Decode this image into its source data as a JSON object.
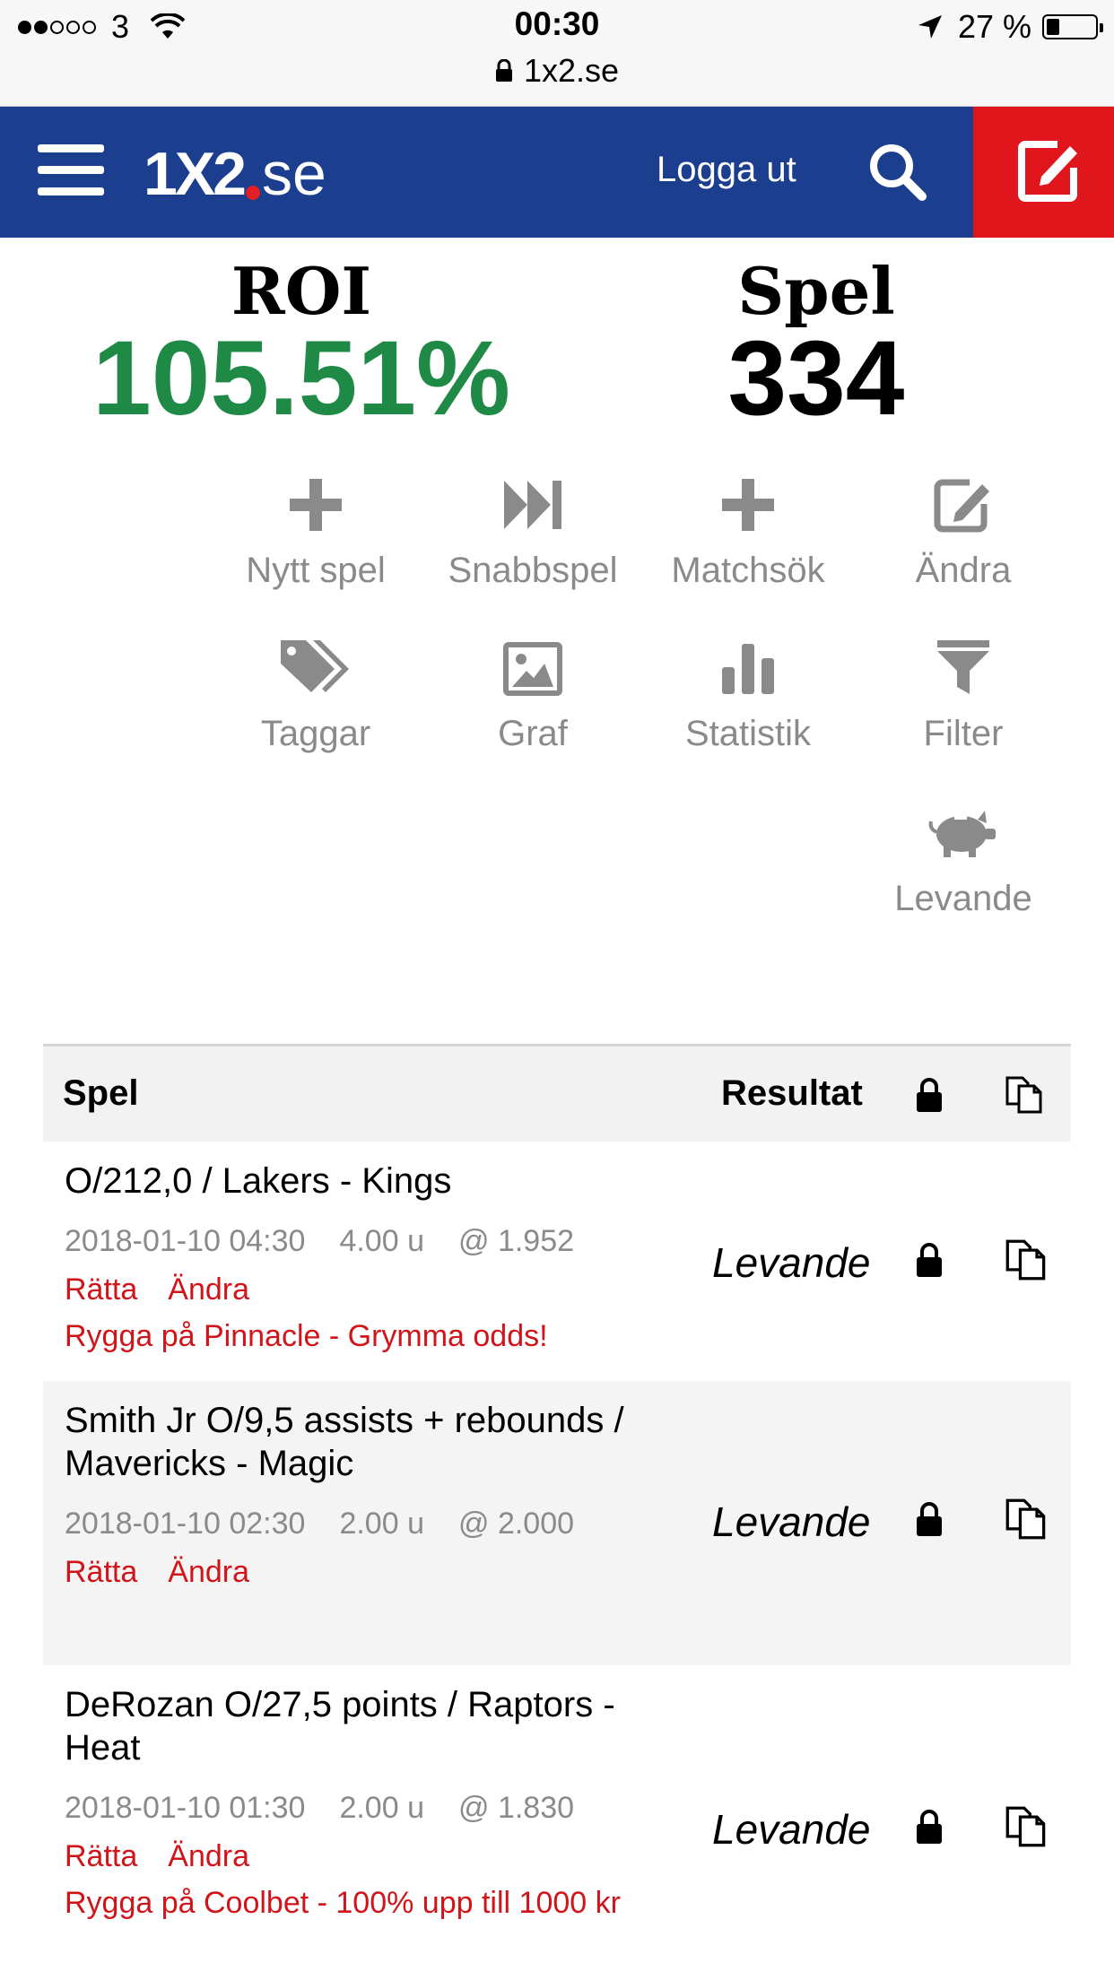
{
  "status_bar": {
    "carrier": "3",
    "time": "00:30",
    "url": "1x2.se",
    "battery": "27 %",
    "battery_level": 0.27
  },
  "header": {
    "logo_main": "1X2",
    "logo_suffix": "se",
    "logout_label": "Logga ut",
    "brand_blue": "#1b3f8e",
    "brand_red": "#e0161c"
  },
  "stats": {
    "roi_label": "ROI",
    "roi_value": "105.51%",
    "roi_color": "#1e8a46",
    "games_label": "Spel",
    "games_value": "334"
  },
  "actions": [
    {
      "label": "Nytt spel",
      "icon": "plus-icon"
    },
    {
      "label": "Snabbspel",
      "icon": "fast-forward-icon"
    },
    {
      "label": "Matchsök",
      "icon": "plus-icon"
    },
    {
      "label": "Ändra",
      "icon": "edit-icon"
    },
    {
      "label": "Taggar",
      "icon": "tags-icon"
    },
    {
      "label": "Graf",
      "icon": "image-icon"
    },
    {
      "label": "Statistik",
      "icon": "bar-chart-icon"
    },
    {
      "label": "Filter",
      "icon": "filter-icon"
    },
    {
      "label": "Levande",
      "icon": "piggy-bank-icon"
    }
  ],
  "table": {
    "col_bet": "Spel",
    "col_result": "Resultat",
    "rows": [
      {
        "title": "O/212,0 / Lakers - Kings",
        "date": "2018-01-10 04:30",
        "units": "4.00 u",
        "odds": "@ 1.952",
        "link_fix": "Rätta",
        "link_edit": "Ändra",
        "promo": "Rygga på Pinnacle - Grymma odds!",
        "status": "Levande"
      },
      {
        "title": "Smith Jr O/9,5 assists + rebounds / Mavericks - Magic",
        "date": "2018-01-10 02:30",
        "units": "2.00 u",
        "odds": "@ 2.000",
        "link_fix": "Rätta",
        "link_edit": "Ändra",
        "promo": "",
        "status": "Levande"
      },
      {
        "title": "DeRozan O/27,5 points / Raptors - Heat",
        "date": "2018-01-10 01:30",
        "units": "2.00 u",
        "odds": "@ 1.830",
        "link_fix": "Rätta",
        "link_edit": "Ändra",
        "promo": "Rygga på Coolbet - 100% upp till 1000 kr",
        "status": "Levande"
      }
    ]
  }
}
